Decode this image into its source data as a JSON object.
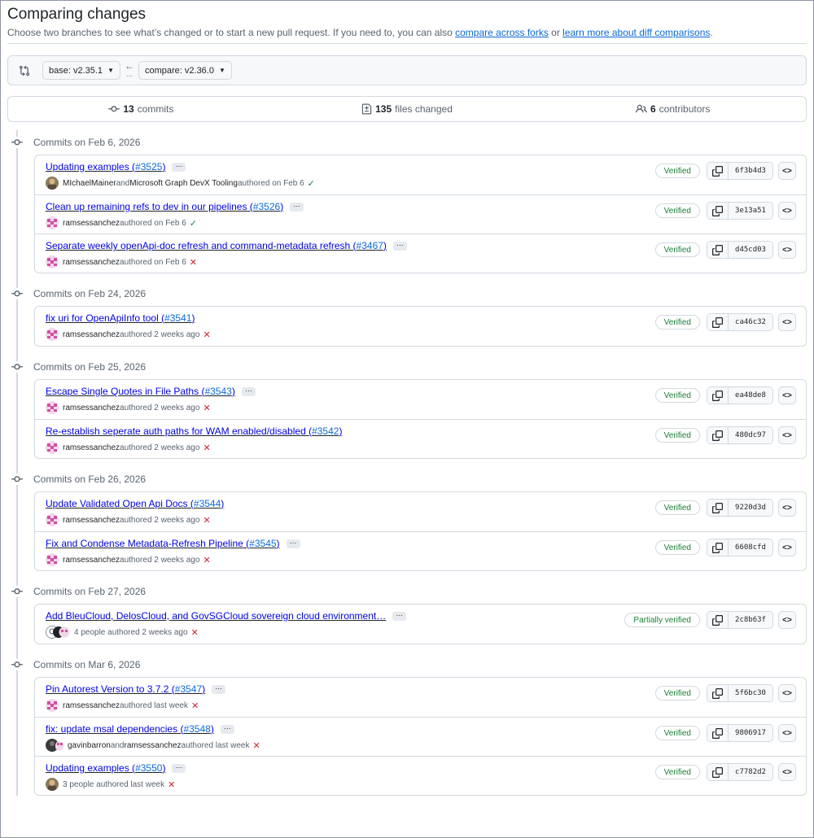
{
  "header": {
    "title": "Comparing changes",
    "subtitle_before": "Choose two branches to see what’s changed or to start a new pull request. If you need to, you can also ",
    "link_forks": "compare across forks",
    "subtitle_mid": " or ",
    "link_learn": "learn more about diff comparisons",
    "subtitle_end": "."
  },
  "range": {
    "base": "base: v2.35.1",
    "compare": "compare: v2.36.0"
  },
  "summary": {
    "commits_count": "13",
    "commits_label": "commits",
    "files_count": "135",
    "files_label": "files changed",
    "contributors_count": "6",
    "contributors_label": "contributors"
  },
  "groups": [
    {
      "date": "Commits on Feb 6, 2026",
      "commits": [
        {
          "title": "Updating examples (",
          "pr": "#3525",
          "close": ")",
          "ellipsis": true,
          "authors": "MIchaelMainer",
          "and": " and ",
          "coauthor": "Microsoft Graph DevX Tooling",
          "when": " authored on Feb 6",
          "status": "ok",
          "verified": "Verified",
          "sha": "6f3b4d3",
          "avatar": "photo"
        },
        {
          "title": "Clean up remaining refs to dev in our pipelines (",
          "pr": "#3526",
          "close": ")",
          "ellipsis": true,
          "authors": "ramsessanchez",
          "and": "",
          "coauthor": "",
          "when": " authored on Feb 6",
          "status": "ok",
          "verified": "Verified",
          "sha": "3e13a51",
          "avatar": "pink"
        },
        {
          "title": "Separate weekly openApi-doc refresh and command-metadata refresh (",
          "pr": "#3467",
          "close": ")",
          "ellipsis": true,
          "authors": "ramsessanchez",
          "and": "",
          "coauthor": "",
          "when": " authored on Feb 6",
          "status": "fail",
          "verified": "Verified",
          "sha": "d45cd03",
          "avatar": "pink"
        }
      ]
    },
    {
      "date": "Commits on Feb 24, 2026",
      "commits": [
        {
          "title": "fix uri for OpenApiInfo tool (",
          "pr": "#3541",
          "close": ")",
          "ellipsis": false,
          "authors": "ramsessanchez",
          "and": "",
          "coauthor": "",
          "when": " authored 2 weeks ago",
          "status": "fail",
          "verified": "Verified",
          "sha": "ca46c32",
          "avatar": "pink"
        }
      ]
    },
    {
      "date": "Commits on Feb 25, 2026",
      "commits": [
        {
          "title": "Escape Single Quotes in File Paths (",
          "pr": "#3543",
          "close": ")",
          "ellipsis": true,
          "authors": "ramsessanchez",
          "and": "",
          "coauthor": "",
          "when": " authored 2 weeks ago",
          "status": "fail",
          "verified": "Verified",
          "sha": "ea48de8",
          "avatar": "pink"
        },
        {
          "title": "Re-establish seperate auth paths for WAM enabled/disabled (",
          "pr": "#3542",
          "close": ")",
          "ellipsis": false,
          "authors": "ramsessanchez",
          "and": "",
          "coauthor": "",
          "when": " authored 2 weeks ago",
          "status": "fail",
          "verified": "Verified",
          "sha": "480dc97",
          "avatar": "pink"
        }
      ]
    },
    {
      "date": "Commits on Feb 26, 2026",
      "commits": [
        {
          "title": "Update Validated Open Api Docs (",
          "pr": "#3544",
          "close": ")",
          "ellipsis": false,
          "authors": "ramsessanchez",
          "and": "",
          "coauthor": "",
          "when": " authored 2 weeks ago",
          "status": "fail",
          "verified": "Verified",
          "sha": "9220d3d",
          "avatar": "pink"
        },
        {
          "title": "Fix and Condense Metadata-Refresh Pipeline (",
          "pr": "#3545",
          "close": ")",
          "ellipsis": true,
          "authors": "ramsessanchez",
          "and": "",
          "coauthor": "",
          "when": " authored 2 weeks ago",
          "status": "fail",
          "verified": "Verified",
          "sha": "6608cfd",
          "avatar": "pink"
        }
      ]
    },
    {
      "date": "Commits on Feb 27, 2026",
      "commits": [
        {
          "title": "Add BleuCloud, DelosCloud, and GovSGCloud sovereign cloud environment…",
          "pr": "",
          "close": "",
          "ellipsis": true,
          "authors": "",
          "and": "",
          "coauthor": "",
          "when": "4 people authored 2 weeks ago",
          "status": "fail",
          "verified": "Partially verified",
          "sha": "2c8b63f",
          "avatar": "multi"
        }
      ]
    },
    {
      "date": "Commits on Mar 6, 2026",
      "commits": [
        {
          "title": "Pin Autorest Version to 3.7.2 (",
          "pr": "#3547",
          "close": ")",
          "ellipsis": true,
          "authors": "ramsessanchez",
          "and": "",
          "coauthor": "",
          "when": " authored last week",
          "status": "fail",
          "verified": "Verified",
          "sha": "5f6bc30",
          "avatar": "pink"
        },
        {
          "title": "fix: update msal dependencies (",
          "pr": "#3548",
          "close": ")",
          "ellipsis": true,
          "authors": "gavinbarron",
          "and": " and ",
          "coauthor": "ramsessanchez",
          "when": " authored last week",
          "status": "fail",
          "verified": "Verified",
          "sha": "9806917",
          "avatar": "dark"
        },
        {
          "title": "Updating examples (",
          "pr": "#3550",
          "close": ")",
          "ellipsis": true,
          "authors": "",
          "and": "",
          "coauthor": "",
          "when": "3 people authored last week",
          "status": "fail",
          "verified": "Verified",
          "sha": "c7782d2",
          "avatar": "photo"
        }
      ]
    }
  ],
  "colors": {
    "link": "#0969da",
    "success": "#1a7f37",
    "danger": "#cf222e",
    "border": "#d1d9e0",
    "muted": "#59636e"
  }
}
